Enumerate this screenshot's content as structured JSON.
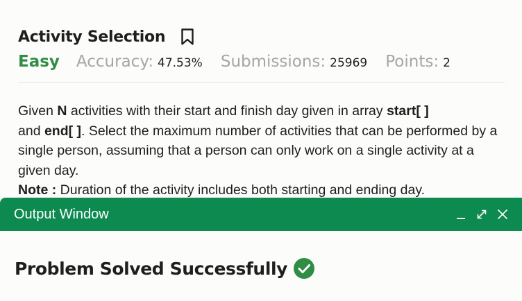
{
  "problem": {
    "title": "Activity Selection",
    "difficulty": "Easy",
    "accuracy_label": "Accuracy:",
    "accuracy_value": "47.53%",
    "submissions_label": "Submissions:",
    "submissions_value": "25969",
    "points_label": "Points:",
    "points_value": "2",
    "bookmark_icon": "bookmark-outline"
  },
  "description": {
    "p1_a": "Given ",
    "p1_n": "N",
    "p1_b": " activities with their start and finish day given in array ",
    "p1_start": "start[ ]",
    "p1_c": "and ",
    "p1_end": "end[ ]",
    "p1_d": ". Select the maximum number of activities that can be performed by a single person, assuming that a person can only work on a single activity at a given day.",
    "note_label": "Note :",
    "note_text": " Duration of the activity includes both starting and ending day."
  },
  "output_window": {
    "title": "Output Window",
    "result_text": "Problem Solved Successfully",
    "accent_color": "#0d8a4f",
    "check_color": "#2f8d46"
  },
  "colors": {
    "difficulty": "#2f8d46",
    "muted_label": "#a6a6a6",
    "text": "#1e1e1e"
  }
}
